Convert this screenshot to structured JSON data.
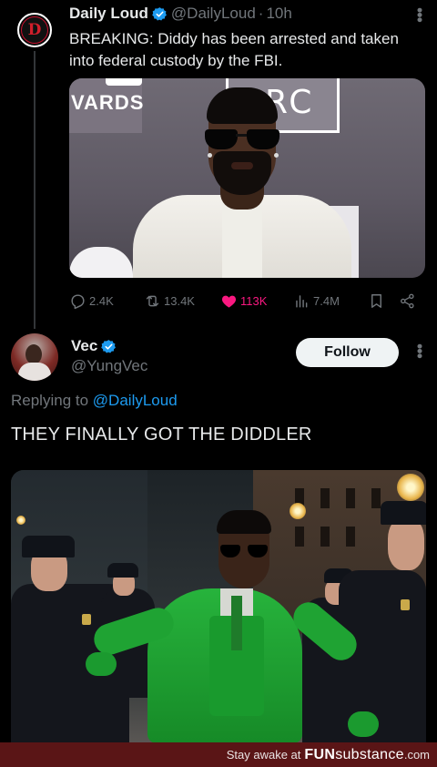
{
  "tweet1": {
    "display_name": "Daily Loud",
    "handle": "@DailyLoud",
    "separator": "·",
    "time": "10h",
    "text": "BREAKING: Diddy has been arrested and taken into federal custody by the FBI.",
    "image_wall_text_left": "VARDS",
    "image_wall_text_right": "MRC",
    "actions": {
      "replies": "2.4K",
      "reposts": "13.4K",
      "likes": "113K",
      "views": "7.4M"
    },
    "colors": {
      "like_accent": "#f91880",
      "verified_badge": "#1d9bf0"
    }
  },
  "tweet2": {
    "display_name": "Vec",
    "handle": "@YungVec",
    "follow_label": "Follow",
    "replying_prefix": "Replying to",
    "replying_to": "@DailyLoud",
    "text": "THEY FINALLY GOT THE DIDDLER"
  },
  "footer": {
    "text": "Stay awake at",
    "brand_main": "FUN",
    "brand_sub": "substance",
    "domain": ".com"
  }
}
